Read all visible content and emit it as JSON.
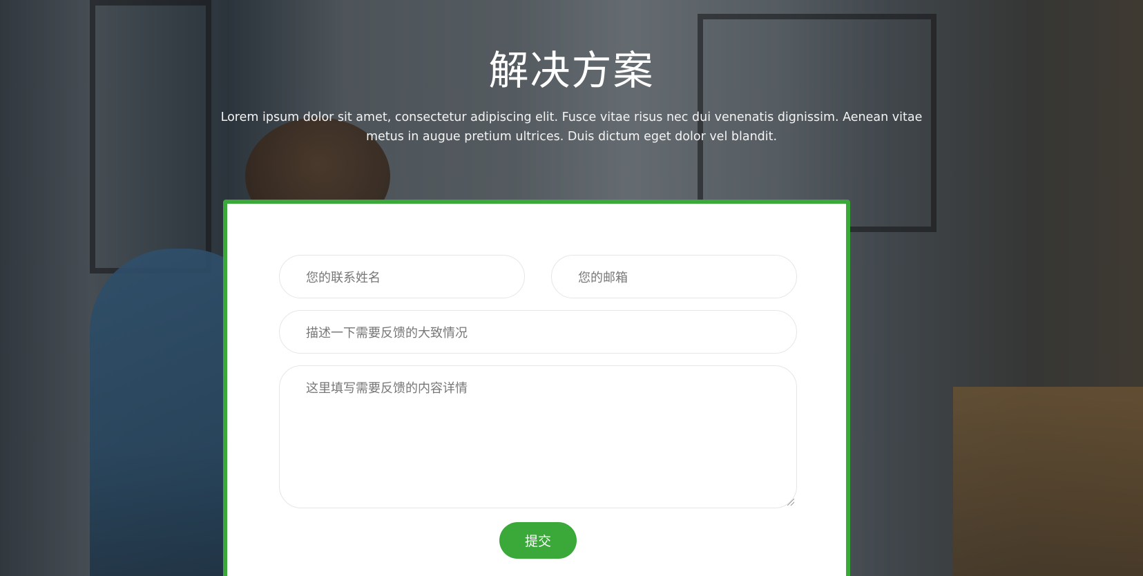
{
  "header": {
    "title": "解决方案",
    "subtitle": "Lorem ipsum dolor sit amet, consectetur adipiscing elit. Fusce vitae risus nec dui venenatis dignissim. Aenean vitae metus in augue pretium ultrices. Duis dictum eget dolor vel blandit."
  },
  "form": {
    "name_placeholder": "您的联系姓名",
    "email_placeholder": "您的邮箱",
    "subject_placeholder": "描述一下需要反馈的大致情况",
    "content_placeholder": "这里填写需要反馈的内容详情",
    "submit_label": "提交"
  },
  "colors": {
    "accent": "#3aa93a",
    "card_background": "#ffffff",
    "title_text": "#ffffff"
  }
}
